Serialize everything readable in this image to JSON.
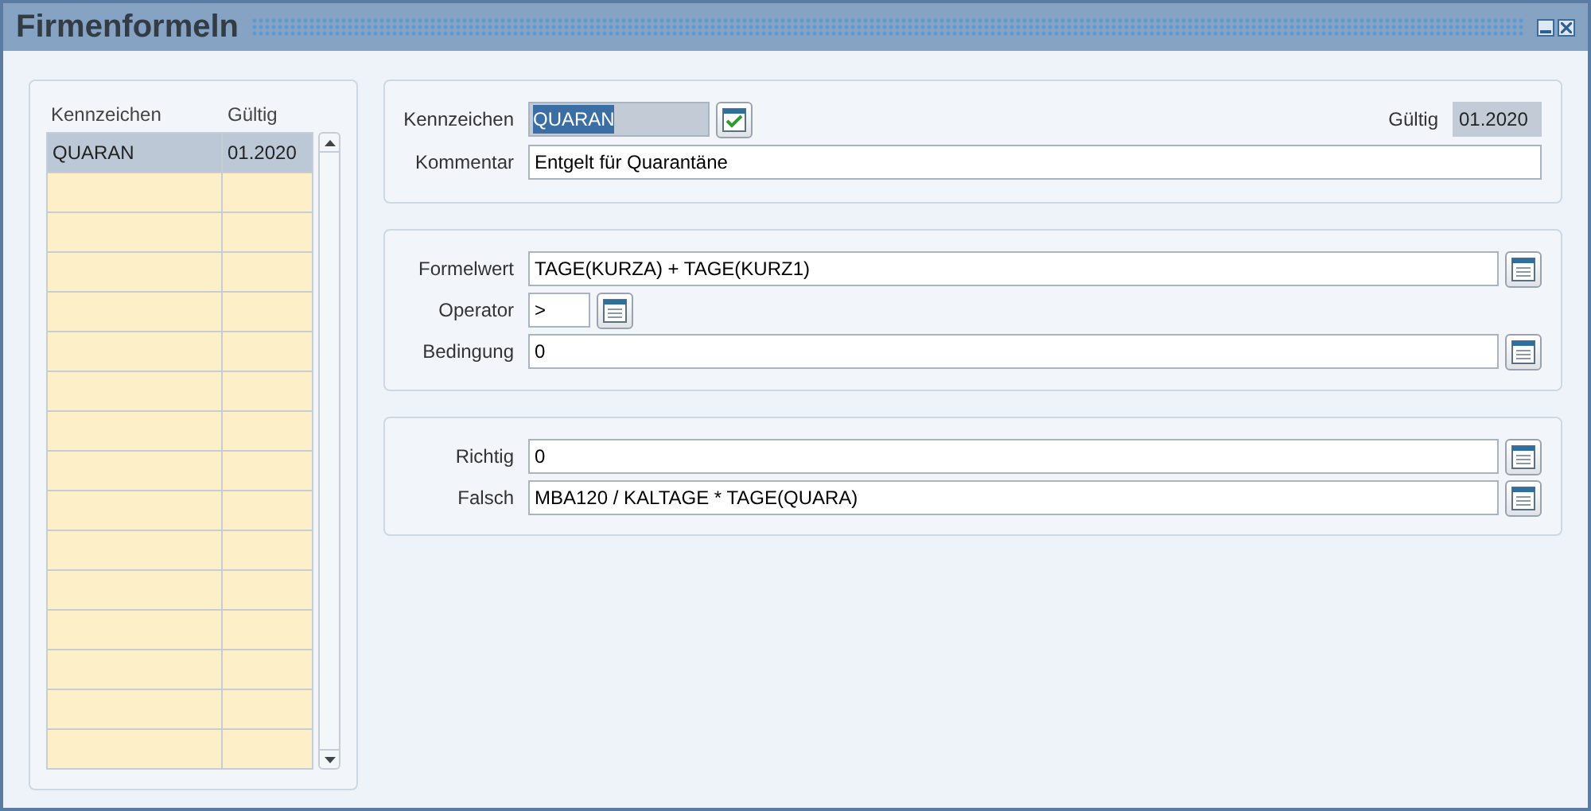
{
  "window": {
    "title": "Firmenformeln"
  },
  "list": {
    "columns": [
      "Kennzeichen",
      "Gültig"
    ],
    "rows": [
      {
        "cells": [
          "QUARAN",
          "01.2020"
        ],
        "selected": true
      }
    ]
  },
  "header": {
    "kennzeichen": {
      "label": "Kennzeichen",
      "value": "QUARAN",
      "selected": true
    },
    "gueltig": {
      "label": "Gültig",
      "value": "01.2020"
    },
    "kommentar": {
      "label": "Kommentar",
      "value": "Entgelt für Quarantäne"
    }
  },
  "condition": [
    {
      "label": "Formelwert",
      "value": "TAGE(KURZA) + TAGE(KURZ1)",
      "kind": "wide"
    },
    {
      "label": "Operator",
      "value": ">",
      "kind": "short"
    },
    {
      "label": "Bedingung",
      "value": "0",
      "kind": "wide"
    }
  ],
  "results": [
    {
      "label": "Richtig",
      "value": "0",
      "kind": "wide"
    },
    {
      "label": "Falsch",
      "value": "MBA120 / KALTAGE * TAGE(QUARA)",
      "kind": "wide"
    }
  ]
}
